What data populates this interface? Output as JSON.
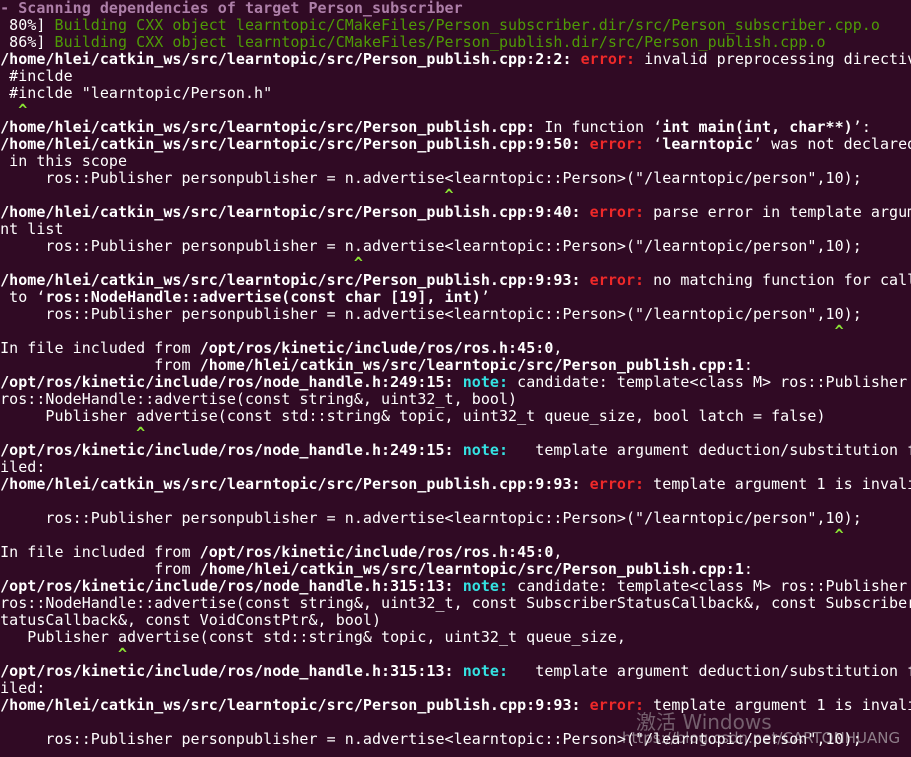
{
  "terminal": {
    "lines": [
      [
        {
          "t": "-- Scanning dependencies of target Person_subscriber",
          "c": "purple b"
        }
      ],
      [
        {
          "t": "[ 80%] "
        },
        {
          "t": "Building CXX object learntopic/CMakeFiles/Person_subscriber.dir/src/Person_subscriber.cpp.o",
          "c": "green"
        }
      ],
      [
        {
          "t": "[ 86%] "
        },
        {
          "t": "Building CXX object learntopic/CMakeFiles/Person_publish.dir/src/Person_publish.cpp.o",
          "c": "green"
        }
      ],
      [
        {
          "t": " /home/hlei/catkin_ws/src/learntopic/src/Person_publish.cpp:2:2: ",
          "c": "b"
        },
        {
          "t": "error: ",
          "c": "red b"
        },
        {
          "t": "invalid preprocessing directiv"
        }
      ],
      [
        {
          "t": "e #inclde"
        }
      ],
      [
        {
          "t": "  #inclde \"learntopic/Person.h\""
        }
      ],
      [
        {
          "t": "   ^",
          "c": "caret"
        }
      ],
      [
        {
          "t": " /home/hlei/catkin_ws/src/learntopic/src/Person_publish.cpp:",
          "c": "b"
        },
        {
          "t": " In function ‘"
        },
        {
          "t": "int main(int, char**)",
          "c": "b"
        },
        {
          "t": "’:"
        }
      ],
      [
        {
          "t": " /home/hlei/catkin_ws/src/learntopic/src/Person_publish.cpp:9:50: ",
          "c": "b"
        },
        {
          "t": "error: ",
          "c": "red b"
        },
        {
          "t": "‘"
        },
        {
          "t": "learntopic",
          "c": "b"
        },
        {
          "t": "’ was not declared"
        }
      ],
      [
        {
          "t": "  in this scope"
        }
      ],
      [
        {
          "t": "      ros::Publisher personpublisher = n.advertise<learntopic::Person>(\"/learntopic/person\",10);"
        }
      ],
      [
        {
          "t": "                                                  ^",
          "c": "caret"
        }
      ],
      [
        {
          "t": " /home/hlei/catkin_ws/src/learntopic/src/Person_publish.cpp:9:40: ",
          "c": "b"
        },
        {
          "t": "error: ",
          "c": "red b"
        },
        {
          "t": "parse error in template argum"
        }
      ],
      [
        {
          "t": "ent list"
        }
      ],
      [
        {
          "t": "      ros::Publisher personpublisher = n.advertise<learntopic::Person>(\"/learntopic/person\",10);"
        }
      ],
      [
        {
          "t": "                                        ^",
          "c": "caret"
        }
      ],
      [
        {
          "t": " /home/hlei/catkin_ws/src/learntopic/src/Person_publish.cpp:9:93: ",
          "c": "b"
        },
        {
          "t": "error: ",
          "c": "red b"
        },
        {
          "t": "no matching function for call"
        }
      ],
      [
        {
          "t": "  to ‘"
        },
        {
          "t": "ros::NodeHandle::advertise(const char [19], int)",
          "c": "b"
        },
        {
          "t": "’"
        }
      ],
      [
        {
          "t": "      ros::Publisher personpublisher = n.advertise<learntopic::Person>(\"/learntopic/person\",10);"
        }
      ],
      [
        {
          "t": "                                                                                             ^",
          "c": "caret"
        }
      ],
      [
        {
          "t": " In file included from "
        },
        {
          "t": "/opt/ros/kinetic/include/ros/ros.h:45:0",
          "c": "b"
        },
        {
          "t": ","
        }
      ],
      [
        {
          "t": "                  from "
        },
        {
          "t": "/home/hlei/catkin_ws/src/learntopic/src/Person_publish.cpp:1",
          "c": "b"
        },
        {
          "t": ":"
        }
      ],
      [
        {
          "t": " /opt/ros/kinetic/include/ros/node_handle.h:249:15: ",
          "c": "b"
        },
        {
          "t": "note: ",
          "c": "cyan b"
        },
        {
          "t": "candidate: template<class M> ros::Publisher"
        }
      ],
      [
        {
          "t": " ros::NodeHandle::advertise(const string&, uint32_t, bool)"
        }
      ],
      [
        {
          "t": "      Publisher advertise(const std::string& topic, uint32_t queue_size, bool latch = false)"
        }
      ],
      [
        {
          "t": "                ^",
          "c": "caret"
        }
      ],
      [
        {
          "t": " /opt/ros/kinetic/include/ros/node_handle.h:249:15: ",
          "c": "b"
        },
        {
          "t": "note: ",
          "c": "cyan b"
        },
        {
          "t": "  template argument deduction/substitution f"
        }
      ],
      [
        {
          "t": "ailed:"
        }
      ],
      [
        {
          "t": " /home/hlei/catkin_ws/src/learntopic/src/Person_publish.cpp:9:93: ",
          "c": "b"
        },
        {
          "t": "error: ",
          "c": "red b"
        },
        {
          "t": "template argument 1 is invali"
        }
      ],
      [
        {
          "t": "d"
        }
      ],
      [
        {
          "t": "      ros::Publisher personpublisher = n.advertise<learntopic::Person>(\"/learntopic/person\",10);"
        }
      ],
      [
        {
          "t": "                                                                                             ^",
          "c": "caret"
        }
      ],
      [
        {
          "t": " In file included from "
        },
        {
          "t": "/opt/ros/kinetic/include/ros/ros.h:45:0",
          "c": "b"
        },
        {
          "t": ","
        }
      ],
      [
        {
          "t": "                  from "
        },
        {
          "t": "/home/hlei/catkin_ws/src/learntopic/src/Person_publish.cpp:1",
          "c": "b"
        },
        {
          "t": ":"
        }
      ],
      [
        {
          "t": " /opt/ros/kinetic/include/ros/node_handle.h:315:13: ",
          "c": "b"
        },
        {
          "t": "note: ",
          "c": "cyan b"
        },
        {
          "t": "candidate: template<class M> ros::Publisher"
        }
      ],
      [
        {
          "t": " ros::NodeHandle::advertise(const string&, uint32_t, const SubscriberStatusCallback&, const Subscriber"
        }
      ],
      [
        {
          "t": "StatusCallback&, const VoidConstPtr&, bool)"
        }
      ],
      [
        {
          "t": "    Publisher advertise(const std::string& topic, uint32_t queue_size,"
        }
      ],
      [
        {
          "t": "              ^",
          "c": "caret"
        }
      ],
      [
        {
          "t": " /opt/ros/kinetic/include/ros/node_handle.h:315:13: ",
          "c": "b"
        },
        {
          "t": "note: ",
          "c": "cyan b"
        },
        {
          "t": "  template argument deduction/substitution f"
        }
      ],
      [
        {
          "t": "ailed:"
        }
      ],
      [
        {
          "t": " /home/hlei/catkin_ws/src/learntopic/src/Person_publish.cpp:9:93: ",
          "c": "b"
        },
        {
          "t": "error: ",
          "c": "red b"
        },
        {
          "t": "template argument 1 is invali"
        }
      ],
      [
        {
          "t": "d"
        }
      ],
      [
        {
          "t": "      ros::Publisher personpublisher = n.advertise<learntopic::Person>(\"/learntopic/person\",10);"
        }
      ]
    ]
  },
  "watermark": {
    "activate": "激活 Windows",
    "url": "https://blog.csdn.net/CARTONHUANG"
  }
}
